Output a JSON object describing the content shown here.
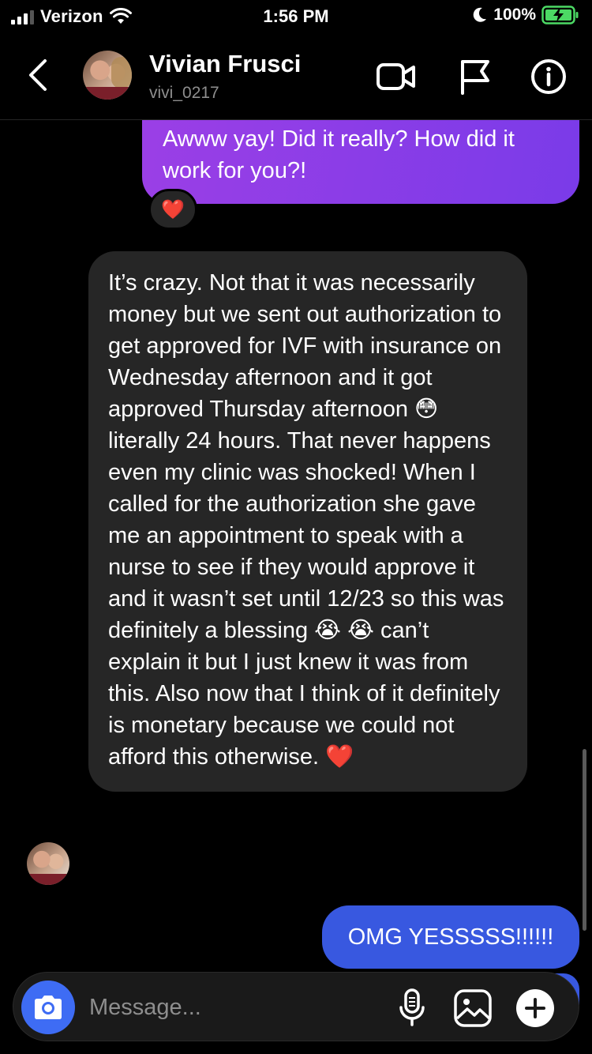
{
  "status_bar": {
    "carrier": "Verizon",
    "time": "1:56 PM",
    "battery": "100%"
  },
  "header": {
    "name": "Vivian Frusci",
    "username": "vivi_0217",
    "icons": [
      "back-chevron-icon",
      "video-call-icon",
      "flag-icon",
      "info-icon"
    ]
  },
  "messages": [
    {
      "direction": "outgoing",
      "text": "Awww yay! Did it really? How did it work for you?!",
      "reaction": "❤️"
    },
    {
      "direction": "incoming",
      "text": "It’s crazy. Not that it was necessarily money but we sent out authorization to get approved for IVF with insurance on Wednesday afternoon and it got approved Thursday afternoon 😳 literally 24 hours. That never happens even my clinic was shocked! When I called for the authorization she gave me an appointment to speak with a nurse to see if they would approve it and it wasn’t set until 12/23 so this was definitely a blessing 😭 😭 can’t explain it but I just knew it was from this. Also now that I think of it definitely is monetary because we could not afford this otherwise. ❤️"
    },
    {
      "direction": "outgoing",
      "text": "OMG YESSSSS!!!!!!"
    }
  ],
  "composer": {
    "placeholder": "Message...",
    "icons": [
      "camera-icon",
      "microphone-icon",
      "gallery-icon",
      "add-icon"
    ]
  },
  "colors": {
    "outgoing_purple": "#8a3de8",
    "outgoing_blue": "#3858e0",
    "incoming_bg": "#262626",
    "camera_blue": "#3e6cf4"
  }
}
